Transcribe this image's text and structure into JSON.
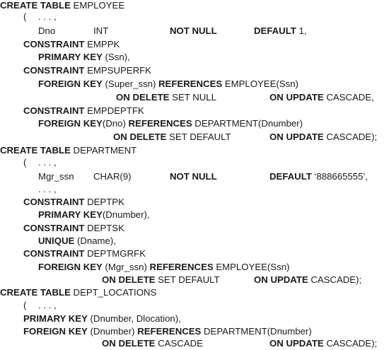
{
  "lines": {
    "l01": {
      "kw1": "CREATE TABLE",
      "t1": " EMPLOYEE"
    },
    "l02": {
      "t1": "(",
      "t2": ". . . ,"
    },
    "l03": {
      "c1": "Dno",
      "c2": "INT",
      "c3": "NOT NULL",
      "c4a": "DEFAULT",
      "c4b": " 1,"
    },
    "l04": {
      "kw1": "CONSTRAINT",
      "t1": " EMPPK"
    },
    "l05": {
      "kw1": "PRIMARY KEY",
      "t1": " (Ssn),"
    },
    "l06": {
      "kw1": "CONSTRAINT",
      "t1": " EMPSUPERFK"
    },
    "l07": {
      "kw1": "FOREIGN KEY",
      "t1": " (Super_ssn) ",
      "kw2": "REFERENCES",
      "t2": " EMPLOYEE(Ssn)"
    },
    "l08": {
      "a1": "ON DELETE",
      "a2": " SET NULL",
      "b1": "ON UPDATE",
      "b2": " CASCADE,"
    },
    "l09": {
      "kw1": "CONSTRAINT",
      "t1": " EMPDEPTFK"
    },
    "l10": {
      "kw1": "FOREIGN KEY",
      "t1": "(Dno) ",
      "kw2": "REFERENCES",
      "t2": " DEPARTMENT(Dnumber)"
    },
    "l11": {
      "a1": "ON DELETE",
      "a2": " SET DEFAULT",
      "b1": "ON UPDATE",
      "b2": " CASCADE);"
    },
    "l12": {
      "kw1": "CREATE TABLE",
      "t1": " DEPARTMENT"
    },
    "l13": {
      "t1": "(",
      "t2": ". . . ,"
    },
    "l14": {
      "c1": "Mgr_ssn",
      "c2": "CHAR(9)",
      "c3": "NOT NULL",
      "c4a": "DEFAULT",
      "c4b": " ‘888665555’,"
    },
    "l15": {
      "t1": ". . . ,"
    },
    "l16": {
      "kw1": "CONSTRAINT",
      "t1": " DEPTPK"
    },
    "l17": {
      "kw1": "PRIMARY KEY",
      "t1": "(Dnumber),"
    },
    "l18": {
      "kw1": "CONSTRAINT",
      "t1": " DEPTSK"
    },
    "l19": {
      "kw1": "UNIQUE",
      "t1": " (Dname),"
    },
    "l20": {
      "kw1": "CONSTRAINT",
      "t1": " DEPTMGRFK"
    },
    "l21": {
      "kw1": "FOREIGN KEY",
      "t1": " (Mgr_ssn) ",
      "kw2": "REFERENCES",
      "t2": " EMPLOYEE(Ssn)"
    },
    "l22": {
      "a1": "ON DELETE",
      "a2": " SET DEFAULT",
      "b1": "ON UPDATE",
      "b2": " CASCADE);"
    },
    "l23": {
      "kw1": "CREATE TABLE",
      "t1": " DEPT_LOCATIONS"
    },
    "l24": {
      "t1": "(",
      "t2": ". . . ,"
    },
    "l25": {
      "kw1": "PRIMARY KEY",
      "t1": " (Dnumber, Dlocation),"
    },
    "l26": {
      "kw1": "FOREIGN KEY",
      "t1": " (Dnumber) ",
      "kw2": "REFERENCES",
      "t2": " DEPARTMENT(Dnumber)"
    },
    "l27": {
      "a1": "ON DELETE",
      "a2": " CASCADE",
      "b1": "ON UPDATE",
      "b2": " CASCADE);"
    }
  }
}
